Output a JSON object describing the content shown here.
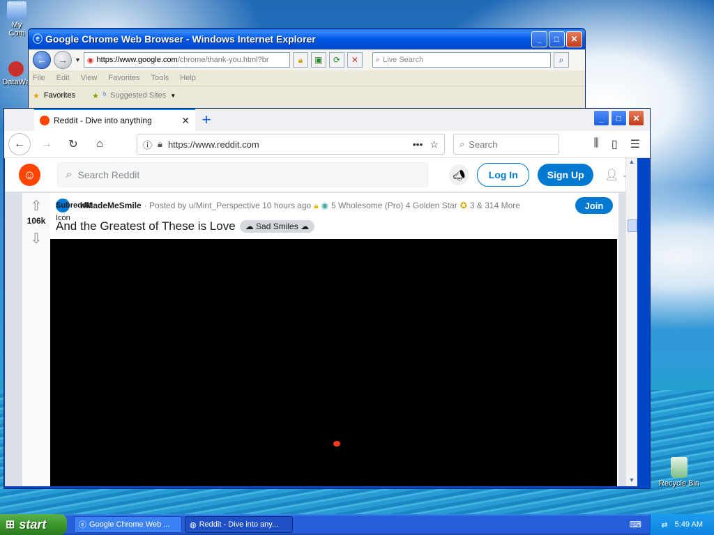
{
  "desktop": {
    "icons": {
      "my_computer": "My Com",
      "datawave": "DataWa",
      "recycle_bin": "Recycle Bin"
    }
  },
  "ie_window": {
    "title": "Google Chrome Web Browser - Windows Internet Explorer",
    "url_prefix": "https://www.google.com",
    "url_rest": "/chrome/thank-you.html?br",
    "search_placeholder": "Live Search",
    "menu": [
      "File",
      "Edit",
      "View",
      "Favorites",
      "Tools",
      "Help"
    ],
    "favorites_label": "Favorites",
    "suggested_sites": "Suggested Sites"
  },
  "ff_window": {
    "tab_title": "Reddit - Dive into anything",
    "url": "https://www.reddit.com",
    "search_placeholder": "Search"
  },
  "reddit": {
    "search_placeholder": "Search Reddit",
    "login_label": "Log In",
    "signup_label": "Sign Up",
    "post": {
      "score": "106k",
      "subreddit_icon_alt": "Subreddit",
      "subreddit": "r/MadeMeSmile",
      "posted_by": "· Posted by u/Mint_Perspective 10 hours ago",
      "awards": "5 Wholesome (Pro) 4 Golden Star",
      "awards_more": "3 & 314 More",
      "join_label": "Join",
      "icon_text": "Icon",
      "title": "And the Greatest of These is Love",
      "flair": "Sad Smiles"
    }
  },
  "taskbar": {
    "start_label": "start",
    "tasks": [
      {
        "label": "Google Chrome Web ..."
      },
      {
        "label": "Reddit - Dive into any..."
      }
    ],
    "clock": "5:49 AM"
  }
}
